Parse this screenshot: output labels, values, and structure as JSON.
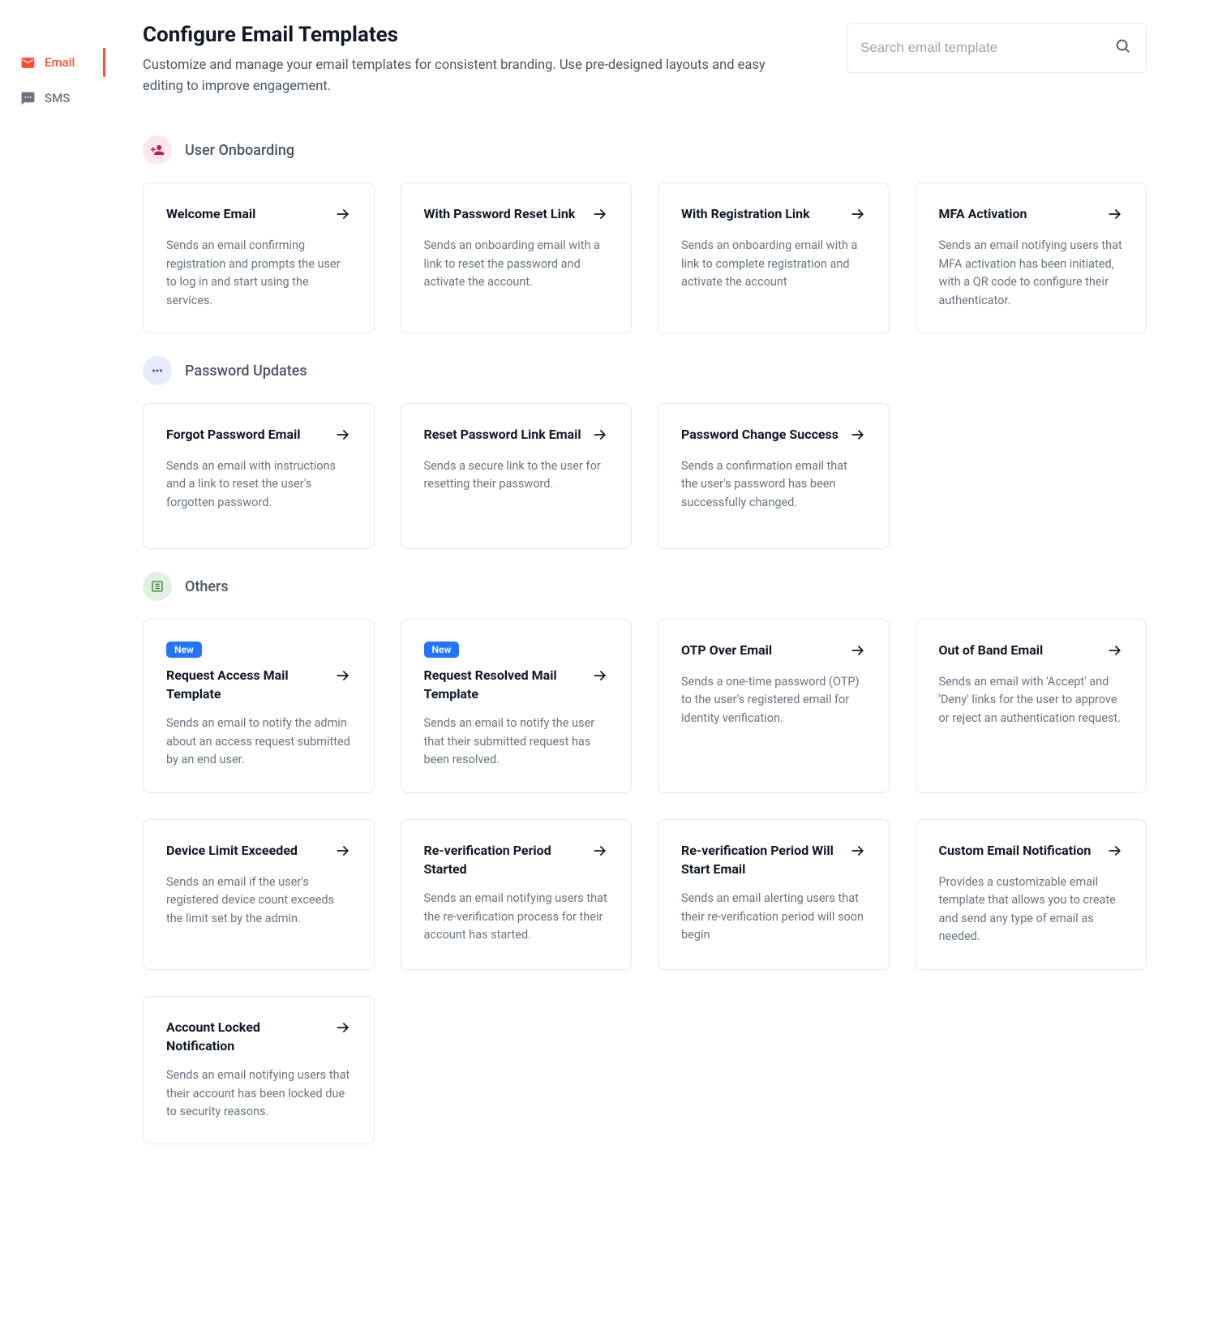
{
  "sidebar": {
    "items": [
      {
        "label": "Email",
        "active": true,
        "icon": "email"
      },
      {
        "label": "SMS",
        "active": false,
        "icon": "sms"
      }
    ]
  },
  "header": {
    "title": "Configure Email Templates",
    "subtitle": "Customize and manage your email templates for consistent branding. Use pre-designed layouts and easy editing to improve engagement."
  },
  "search": {
    "placeholder": "Search email template"
  },
  "sections": [
    {
      "title": "User Onboarding",
      "icon": "person_add",
      "iconClass": "pink",
      "cards": [
        {
          "title": "Welcome Email",
          "desc": "Sends an email confirming registration and prompts the user to log in and start using the services."
        },
        {
          "title": "With Password Reset Link",
          "desc": "Sends an onboarding email with a link to reset the password and activate the account."
        },
        {
          "title": "With Registration Link",
          "desc": "Sends an onboarding email with a link to complete registration and activate the account"
        },
        {
          "title": "MFA Activation",
          "desc": "Sends an email notifying users that MFA activation has been initiated, with a QR code to configure their authenticator."
        }
      ]
    },
    {
      "title": "Password Updates",
      "icon": "password",
      "iconClass": "blue",
      "cards": [
        {
          "title": "Forgot Password Email",
          "desc": "Sends an email with instructions and a link to reset the user's forgotten password."
        },
        {
          "title": "Reset Password Link Email",
          "desc": "Sends a secure link to the user for resetting their password."
        },
        {
          "title": "Password Change Success",
          "desc": "Sends a confirmation email that the user's password has been successfully changed."
        }
      ]
    },
    {
      "title": "Others",
      "icon": "list",
      "iconClass": "green",
      "cards": [
        {
          "badge": "New",
          "title": "Request Access Mail Template",
          "desc": "Sends an email to notify the admin about an access request submitted by an end user."
        },
        {
          "badge": "New",
          "title": "Request Resolved Mail Template",
          "desc": "Sends an email to notify the user that their submitted request has been resolved."
        },
        {
          "title": "OTP Over Email",
          "desc": "Sends a one-time password (OTP) to the user's registered email for identity verification."
        },
        {
          "title": "Out of Band Email",
          "desc": "Sends an email with 'Accept' and 'Deny' links for the user to approve or reject an authentication request."
        },
        {
          "title": "Device Limit Exceeded",
          "desc": "Sends an email if the user's registered device count exceeds the limit set by the admin."
        },
        {
          "title": "Re-verification Period Started",
          "desc": "Sends an email notifying users that the re-verification process for their account has started."
        },
        {
          "title": "Re-verification Period Will Start Email",
          "desc": "Sends an email alerting users that their re-verification period will soon begin"
        },
        {
          "title": "Custom Email Notification",
          "desc": "Provides a customizable email template that allows you to create and send any type of email as needed."
        },
        {
          "title": "Account Locked Notification",
          "desc": "Sends an email notifying users that their account has been locked due to security reasons."
        }
      ]
    }
  ]
}
